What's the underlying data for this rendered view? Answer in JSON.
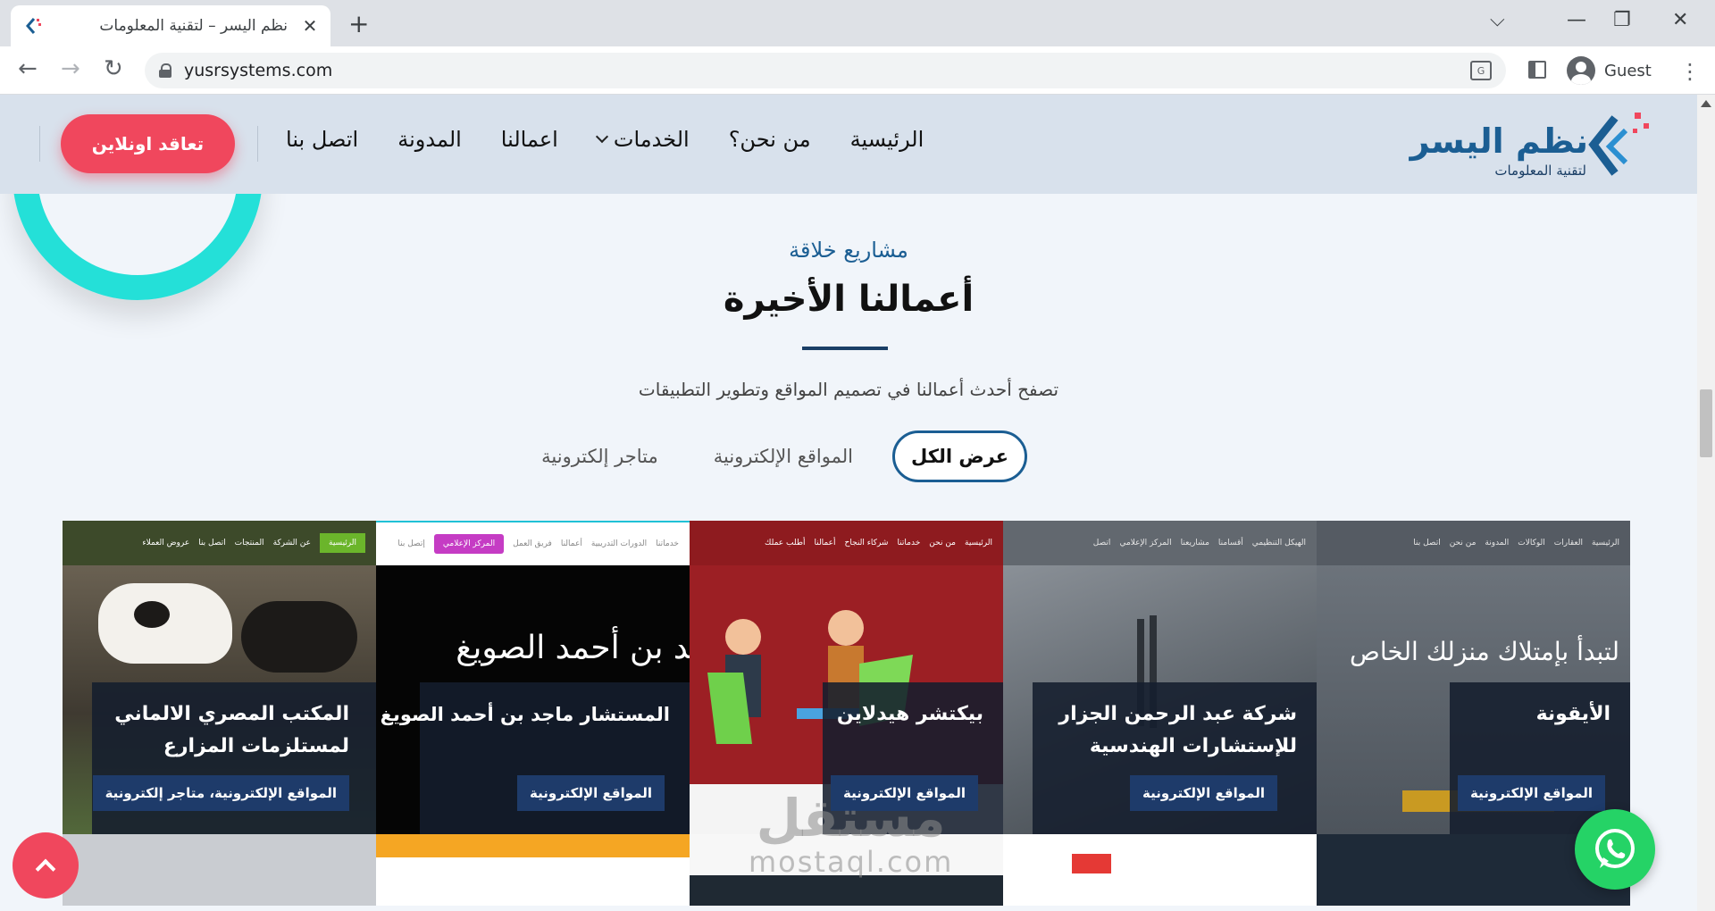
{
  "browser": {
    "tab_title": "نظم اليسر – لتقنية المعلومات",
    "url": "yusrsystems.com",
    "profile_label": "Guest",
    "new_tab_glyph": "+",
    "close_glyph": "✕"
  },
  "site": {
    "logo_text": "نظم اليسر",
    "logo_subtitle": "لتقنية المعلومات",
    "nav": [
      "الرئيسية",
      "من نحن؟",
      "الخدمات",
      "اعمالنا",
      "المدونة",
      "اتصل بنا"
    ],
    "cta_label": "تعاقد اونلاين"
  },
  "section": {
    "kicker": "مشاريع خلاقة",
    "heading": "أعمالنا الأخيرة",
    "lead": "تصفح أحدث أعمالنا في تصميم المواقع وتطوير التطبيقات",
    "filters": [
      "عرض الكل",
      "المواقع الإلكترونية",
      "متاجر إلكترونية"
    ]
  },
  "cards": [
    {
      "title_line1": "الأيقونة",
      "title_line2": "",
      "tag": "المواقع الإلكترونية",
      "hero_text": "لتبدأ بإمتلاك منزلك الخاص",
      "topbar": [
        "الرئيسية",
        "العقارات",
        "الوكالات",
        "المدونة",
        "من نحن",
        "اتصل بنا"
      ]
    },
    {
      "title_line1": "شركة عبد الرحمن الجزار",
      "title_line2": "للإستشارات الهندسية",
      "tag": "المواقع الإلكترونية",
      "hero_text": "",
      "topbar": [
        "الهيكل التنظيمي",
        "أقسامنا",
        "مشاريعنا",
        "المركز الإعلامي",
        "اتصل"
      ]
    },
    {
      "title_line1": "بيكتشر هيدلاين",
      "title_line2": "",
      "tag": "المواقع الإلكترونية",
      "hero_text": "",
      "topbar": [
        "الرئيسية",
        "من نحن",
        "خدماتنا",
        "شركاء النجاح",
        "أعمالنا",
        "أطلب عملك"
      ]
    },
    {
      "title_line1": "المستشار ماجد بن أحمد الصويغ",
      "title_line2": "",
      "tag": "المواقع الإلكترونية",
      "hero_text": "المستشار ماجد بن أحمد الصويغ",
      "topbar": [
        "خدماتنا",
        "الدورات التدريبية",
        "أعمالنا",
        "فريق العمل",
        "المركز الإعلامي",
        "إتصل بنا"
      ]
    },
    {
      "title_line1": "المكتب المصري الالماني",
      "title_line2": "لمستلزمات المزارع",
      "tag": "المواقع الإلكترونية، متاجر إلكترونية",
      "hero_text": "",
      "topbar": [
        "الرئيسية",
        "عن الشركة",
        "المنتجات",
        "اتصل بنا",
        "عروض العملاء"
      ]
    }
  ],
  "watermark": {
    "ar": "مستقل",
    "en": "mostaql.com"
  },
  "colors": {
    "accent": "#f0475d",
    "brand": "#1b5e93",
    "teal": "#24e0d8",
    "whatsapp": "#25d366"
  },
  "icons": [
    "whatsapp-icon",
    "chevron-up-icon",
    "lock-icon",
    "translate-icon"
  ]
}
